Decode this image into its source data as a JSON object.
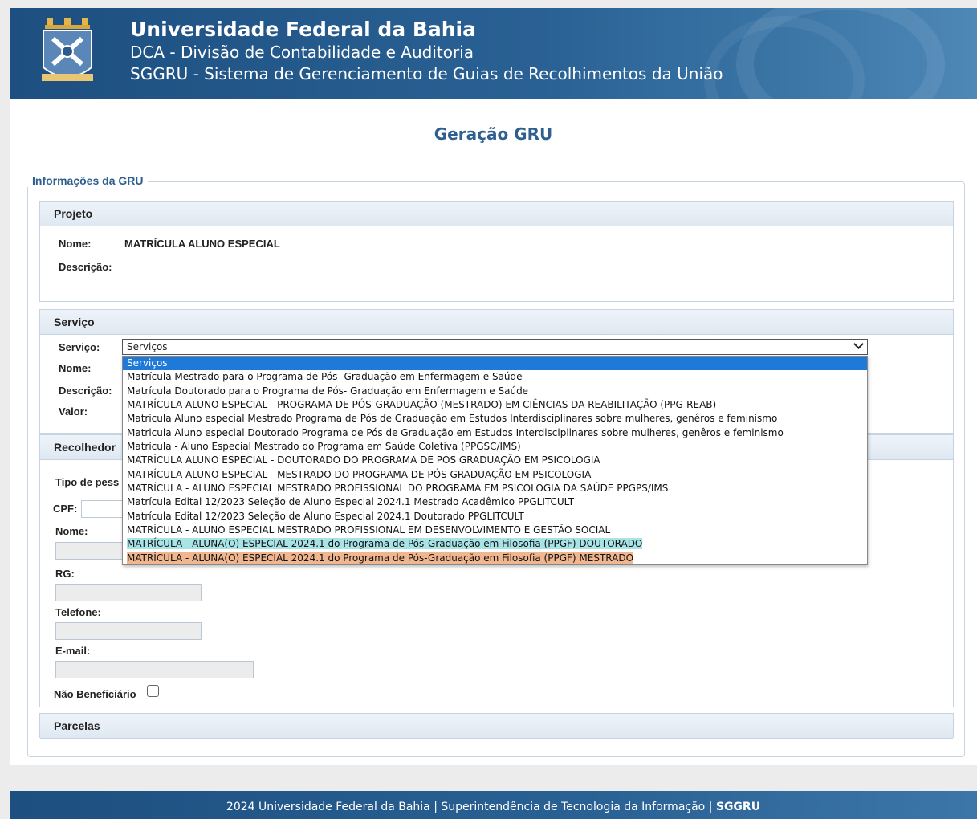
{
  "header": {
    "title": "Universidade Federal da Bahia",
    "subtitle1": "DCA - Divisão de Contabilidade e Auditoria",
    "subtitle2": "SGGRU - Sistema de Gerenciamento de Guias de Recolhimentos da União"
  },
  "page_title": "Geração GRU",
  "legend": "Informações da GRU",
  "projeto": {
    "heading": "Projeto",
    "nome_label": "Nome:",
    "nome_value": "MATRÍCULA ALUNO ESPECIAL",
    "descricao_label": "Descrição:"
  },
  "servico": {
    "heading": "Serviço",
    "servico_label": "Serviço:",
    "nome_label": "Nome:",
    "descricao_label": "Descrição:",
    "valor_label": "Valor:",
    "selected": "Serviços",
    "options": [
      "Serviços",
      "Matrícula Mestrado para o Programa de Pós- Graduação em Enfermagem e Saúde",
      "Matrícula Doutorado para o Programa de Pós- Graduação em Enfermagem e Saúde",
      "MATRÍCULA ALUNO ESPECIAL - PROGRAMA DE PÓS-GRADUAÇÃO (MESTRADO) EM CIÊNCIAS DA REABILITAÇÃO (PPG-REAB)",
      "Matricula Aluno especial Mestrado Programa de Pós de Graduação em Estudos Interdisciplinares sobre mulheres, genêros e feminismo",
      "Matricula Aluno especial Doutorado Programa de Pós de Graduação em Estudos Interdisciplinares sobre mulheres, genêros e feminismo",
      "Matrícula - Aluno Especial Mestrado do Programa em Saúde Coletiva (PPGSC/IMS)",
      "MATRÍCULA ALUNO ESPECIAL - DOUTORADO DO PROGRAMA DE PÓS GRADUAÇÃO EM PSICOLOGIA",
      "MATRÍCULA ALUNO ESPECIAL - MESTRADO DO PROGRAMA DE PÓS GRADUAÇÃO EM PSICOLOGIA",
      "MATRÍCULA - ALUNO ESPECIAL MESTRADO PROFISSIONAL DO PROGRAMA EM PSICOLOGIA DA SAÚDE PPGPS/IMS",
      "Matrícula Edital 12/2023 Seleção de Aluno Especial 2024.1 Mestrado Acadêmico PPGLITCULT",
      "Matrícula Edital 12/2023 Seleção de Aluno Especial 2024.1 Doutorado PPGLITCULT",
      "MATRÍCULA - ALUNO ESPECIAL MESTRADO PROFISSIONAL EM DESENVOLVIMENTO E GESTÃO SOCIAL",
      "MATRÍCULA - ALUNA(O) ESPECIAL 2024.1 do Programa de Pós-Graduação em Filosofia (PPGF) DOUTORADO",
      "MATRÍCULA - ALUNA(O) ESPECIAL 2024.1 do Programa de Pós-Graduação em Filosofia (PPGF) MESTRADO"
    ]
  },
  "recolhedor": {
    "heading": "Recolhedor",
    "tipo_label": "Tipo de pess",
    "cpf_label": "CPF:",
    "nome_label": "Nome:",
    "rg_label": "RG:",
    "telefone_label": "Telefone:",
    "email_label": "E-mail:",
    "nao_beneficiario_label": "Não Beneficiário"
  },
  "parcelas": {
    "heading": "Parcelas"
  },
  "footer": {
    "text": "2024 Universidade Federal da Bahia | Superintendência de Tecnologia da Informação | ",
    "bold": "SGGRU"
  },
  "colors": {
    "header_bg": "#1d4f80",
    "accent": "#2f5f8e",
    "selected_option": "#1e79d9",
    "highlight_teal": "#a8e3e6",
    "highlight_orange": "#f0b68f"
  }
}
